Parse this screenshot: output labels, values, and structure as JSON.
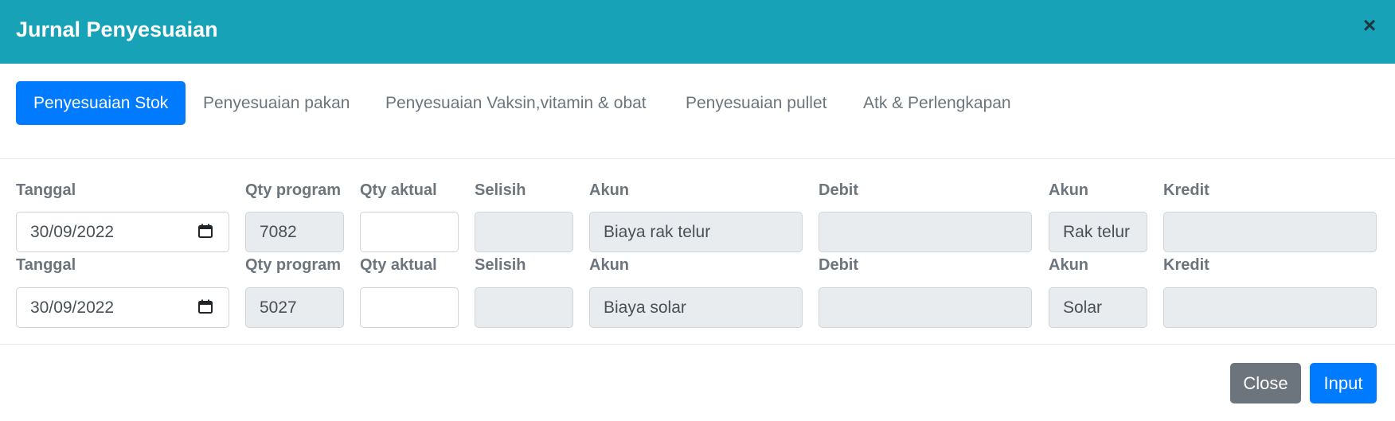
{
  "modal": {
    "title": "Jurnal Penyesuaian",
    "close_glyph": "×"
  },
  "tabs": [
    {
      "label": "Penyesuaian Stok",
      "active": true
    },
    {
      "label": "Penyesuaian pakan"
    },
    {
      "label": "Penyesuaian Vaksin,vitamin & obat"
    },
    {
      "label": "Penyesuaian pullet"
    },
    {
      "label": "Atk & Perlengkapan"
    }
  ],
  "columns": {
    "tanggal": "Tanggal",
    "qty_program": "Qty program",
    "qty_aktual": "Qty aktual",
    "selisih": "Selisih",
    "akun_debit": "Akun",
    "debit": "Debit",
    "akun_kredit": "Akun",
    "kredit": "Kredit"
  },
  "rows": [
    {
      "tanggal": "30/09/2022",
      "qty_program": "7082",
      "qty_aktual": "",
      "selisih": "",
      "akun_debit": "Biaya rak telur",
      "debit": "",
      "akun_kredit": "Rak telur",
      "kredit": ""
    },
    {
      "tanggal": "30/09/2022",
      "qty_program": "5027",
      "qty_aktual": "",
      "selisih": "",
      "akun_debit": "Biaya solar",
      "debit": "",
      "akun_kredit": "Solar",
      "kredit": ""
    }
  ],
  "footer": {
    "close_label": "Close",
    "input_label": "Input"
  },
  "icons": {
    "date_picker": "calendar-icon",
    "modal_close": "close-icon"
  },
  "colors": {
    "header": "#17a2b8",
    "primary": "#007bff",
    "secondary": "#6c757d",
    "readonly": "#e9ecef"
  }
}
